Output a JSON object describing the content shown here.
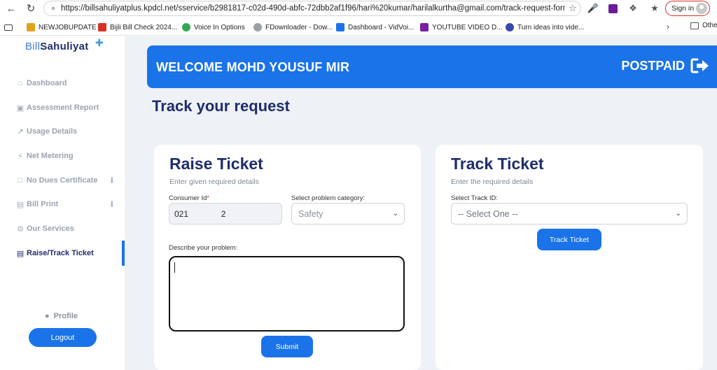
{
  "browser": {
    "url": "https://billsahuliyatplus.kpdcl.net/sservice/b2981817-c02d-490d-abfc-72dbb2af1f96/hari%20kumar/harilalkurtha@gmail.com/track-request-form",
    "signin_label": "Sign in",
    "bookmarks": [
      {
        "label": "NEWJOBUPDATE",
        "icon": "newjob-favicon",
        "color": "#e0a21a"
      },
      {
        "label": "Bijli Bill Check 2024...",
        "icon": "bijli-favicon",
        "color": "#d93025"
      },
      {
        "label": "Voice In Options",
        "icon": "voicein-favicon",
        "color": "#34a853"
      },
      {
        "label": "FDownloader - Dow...",
        "icon": "fdownloader-favicon",
        "color": "#9aa0a6"
      },
      {
        "label": "Dashboard - VidVoi...",
        "icon": "vidvoice-favicon",
        "color": "#1a73e8"
      },
      {
        "label": "YOUTUBE VIDEO D...",
        "icon": "kv-favicon",
        "color": "#7b1fa2"
      },
      {
        "label": "Turn ideas into vide...",
        "icon": "ideas-favicon",
        "color": "#3949ab"
      }
    ],
    "other_bookmarks_label": "Othe"
  },
  "sidebar": {
    "logo_part1": "Bill",
    "logo_part2": "Sahuliyat",
    "items": [
      {
        "label": "Dashboard",
        "icon": "home-icon"
      },
      {
        "label": "Assessment Report",
        "icon": "report-icon"
      },
      {
        "label": "Usage Details",
        "icon": "chart-icon"
      },
      {
        "label": "Net Metering",
        "icon": "bolt-icon"
      },
      {
        "label": "No Dues Certificate",
        "icon": "document-icon",
        "download": true
      },
      {
        "label": "Bill Print",
        "icon": "print-icon",
        "download": true
      },
      {
        "label": "Our Services",
        "icon": "gear-icon"
      },
      {
        "label": "Raise/Track Ticket",
        "icon": "ticket-icon",
        "active": true
      }
    ],
    "profile_label": "Profile",
    "logout_label": "Logout"
  },
  "banner": {
    "welcome": "WELCOME MOHD YOUSUF MIR",
    "plan": "POSTPAID"
  },
  "page_title": "Track your request",
  "raise_ticket": {
    "title": "Raise Ticket",
    "subtitle": "Enter given required details",
    "consumer_id_label": "Consumer Id",
    "consumer_id_value": "021              2",
    "category_label": "Select problem category:",
    "category_value": "Safety",
    "describe_label": "Describe your problem:",
    "describe_value": "",
    "submit_label": "Submit"
  },
  "track_ticket": {
    "title": "Track Ticket",
    "subtitle": "Enter the required details",
    "track_id_label": "Select Track ID:",
    "track_id_value": "-- Select One --",
    "button_label": "Track Ticket"
  },
  "colors": {
    "accent": "#1a73e8",
    "navy": "#1f2d6b",
    "background": "#eef1f6"
  }
}
